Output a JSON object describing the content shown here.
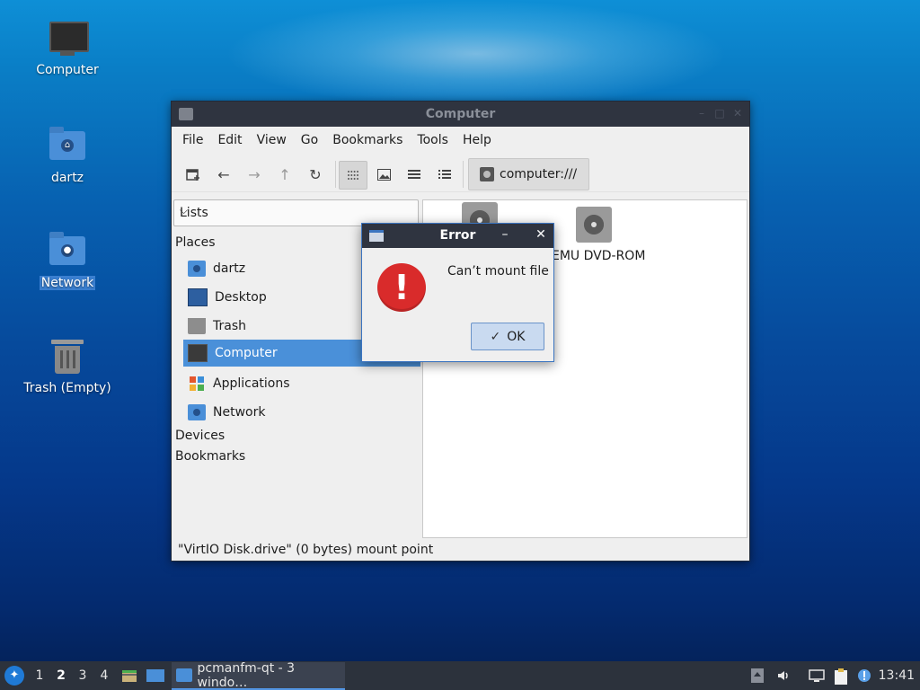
{
  "desktop": {
    "icons": [
      {
        "label": "Computer",
        "icon": "computer-icon"
      },
      {
        "label": "dartz",
        "icon": "home-folder-icon"
      },
      {
        "label": "Network",
        "icon": "network-folder-icon"
      },
      {
        "label": "Trash (Empty)",
        "icon": "trash-icon"
      }
    ]
  },
  "window": {
    "title": "Computer",
    "menu": [
      "File",
      "Edit",
      "View",
      "Go",
      "Bookmarks",
      "Tools",
      "Help"
    ],
    "location": "computer:///",
    "side_pane_mode": "Lists",
    "places_header": "Places",
    "places": [
      "dartz",
      "Desktop",
      "Trash",
      "Computer",
      "Applications",
      "Network"
    ],
    "devices_header": "Devices",
    "bookmarks_header": "Bookmarks",
    "drives": [
      "EMU DVD-ROM"
    ],
    "status": "\"VirtIO Disk.drive\" (0 bytes) mount point"
  },
  "dialog": {
    "title": "Error",
    "message": "Can’t mount file",
    "ok_label": "OK"
  },
  "taskbar": {
    "desktops": [
      "1",
      "2",
      "3",
      "4"
    ],
    "current_desktop": "2",
    "window_button": "pcmanfm-qt - 3 windo…",
    "clock": "13:41"
  },
  "colors": {
    "selection": "#4a90d9",
    "titlebar": "#2f3440",
    "error_icon": "#d92b2b",
    "taskbar": "#2c323c"
  }
}
